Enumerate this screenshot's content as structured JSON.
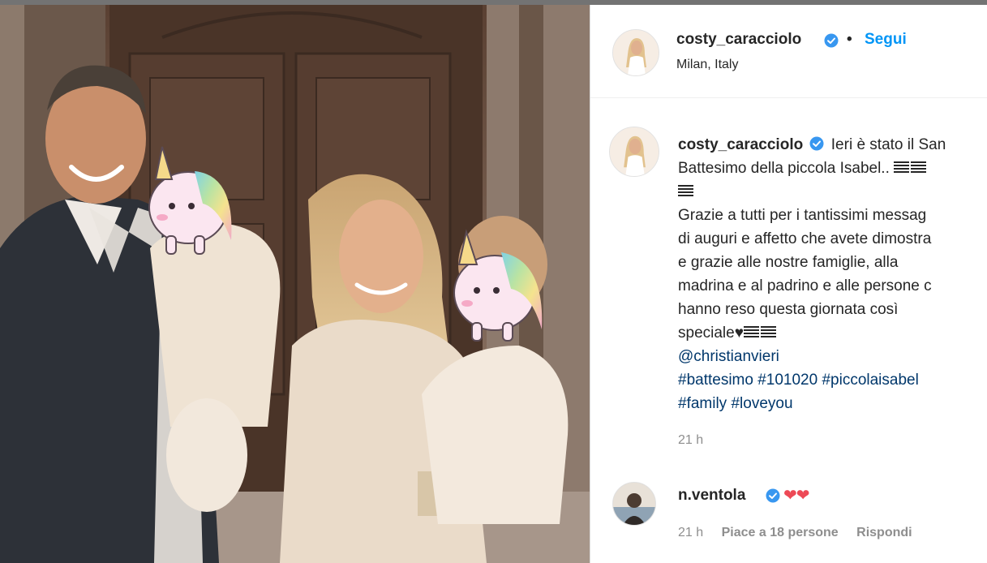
{
  "post": {
    "username": "costy_caracciolo",
    "follow_label": "Segui",
    "separator": "•",
    "location": "Milan, Italy"
  },
  "caption": {
    "username": "costy_caracciolo",
    "line1": "Ieri è stato il San",
    "line2": "Battesimo della piccola Isabel..",
    "line4": "Grazie a tutti per i tantissimi messag",
    "line5": "di auguri e affetto che avete dimostra",
    "line6": "e grazie alle nostre famiglie, alla",
    "line7": "madrina e al padrino e alle persone c",
    "line8": "hanno reso questa giornata così",
    "line9": "speciale♥",
    "mention": "@christianvieri",
    "hashtags_line1": "#battesimo #101020 #piccolaisabel",
    "hashtags_line2": "#family #loveyou",
    "time": "21 h"
  },
  "comment": {
    "username": "n.ventola",
    "text": "❤❤",
    "time": "21 h",
    "likes": "Piace a 18 persone",
    "reply": "Rispondi"
  },
  "colors": {
    "accent_blue": "#0095f6",
    "link_blue": "#00376b",
    "verified_blue": "#3897f0",
    "muted": "#8e8e8e",
    "heart_red": "#ed4956"
  },
  "icons": {
    "verified": "verified-badge-icon",
    "photo_stickers": "unicorn-sticker"
  }
}
